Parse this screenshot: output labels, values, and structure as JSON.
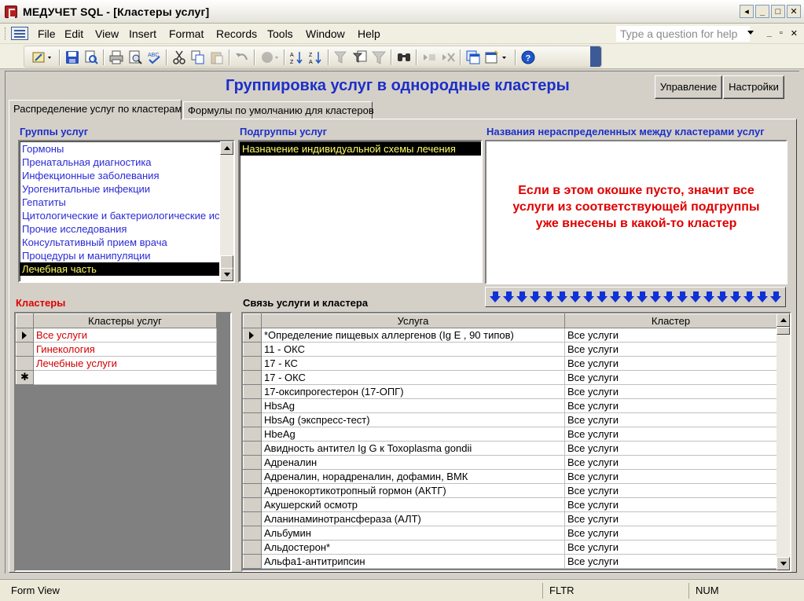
{
  "window": {
    "title": "МЕДУЧЕТ SQL - [Кластеры услуг]",
    "buttons": [
      "◂",
      "_",
      "□",
      "✕"
    ]
  },
  "menubar": {
    "items": [
      "File",
      "Edit",
      "View",
      "Insert",
      "Format",
      "Records",
      "Tools",
      "Window",
      "Help"
    ],
    "help_placeholder": "Type a question for help",
    "mdi_buttons": [
      "_",
      "▫",
      "✕"
    ]
  },
  "toolbar": {
    "icons": [
      "design-view",
      "save",
      "file-search",
      "print",
      "print-preview",
      "spelling",
      "cut",
      "copy",
      "paste",
      "undo",
      "office-links",
      "sort-ascending",
      "sort-descending",
      "filter-by-selection",
      "filter-by-form",
      "apply-filter",
      "find",
      "new-record",
      "delete-record",
      "database-window",
      "new-object",
      "help"
    ],
    "colors": {
      "blue": "#1f56c8",
      "red": "#c03030"
    }
  },
  "form": {
    "title": "Группировка услуг в однородные кластеры",
    "btn_manage": "Управление",
    "btn_settings": "Настройки",
    "tabs": [
      "Распределение услуг по кластерам",
      "Формулы по умолчанию для кластеров"
    ],
    "groups_label": "Группы услуг",
    "subgroups_label": "Подгруппы услуг",
    "unassigned_label": "Названия нераспределенных между кластерами услуг",
    "clusters_label": "Кластеры",
    "link_label": "Связь услуги и кластера",
    "groups": [
      "Гормоны",
      "Пренатальная диагностика",
      "Инфекционные заболевания",
      "Урогенитальные инфекции",
      "Гепатиты",
      "Цитологические и бактериологические исс",
      "Прочие исследования",
      "Консультативный прием врача",
      "Процедуры и манипуляции",
      "Лечебная часть"
    ],
    "groups_selected_index": 9,
    "subgroups": [
      "Назначение индивидуальной схемы лечения"
    ],
    "note": "Если в этом окошке пусто, значит все услуги из соответствующей подгруппы уже внесены в какой-то кластер",
    "clusters_header": "Кластеры услуг",
    "clusters": [
      "Все услуги",
      "Гинекология",
      "Лечебные услуги"
    ],
    "link_headers": [
      "Услуга",
      "Кластер"
    ],
    "services": [
      [
        "*Определение пищевых аллергенов (Ig E , 90 типов)",
        "Все услуги"
      ],
      [
        "11 - ОКС",
        "Все услуги"
      ],
      [
        "17 - КС",
        "Все услуги"
      ],
      [
        "17 - ОКС",
        "Все услуги"
      ],
      [
        "17-оксипрогестерон (17-ОПГ)",
        "Все услуги"
      ],
      [
        "HbsAg",
        "Все услуги"
      ],
      [
        "HbsAg (экспресс-тест)",
        "Все услуги"
      ],
      [
        "HbeAg",
        "Все услуги"
      ],
      [
        "Авидность антител Ig G к Toxoplasma gondii",
        "Все услуги"
      ],
      [
        "Адреналин",
        "Все услуги"
      ],
      [
        "Адреналин, норадреналин, дофамин, ВМК",
        "Все услуги"
      ],
      [
        "Адренокортикотропный гормон (АКТГ)",
        "Все услуги"
      ],
      [
        "Акушерский осмотр",
        "Все услуги"
      ],
      [
        "Аланинаминотрансфераза (АЛТ)",
        "Все услуги"
      ],
      [
        "Альбумин",
        "Все услуги"
      ],
      [
        "Альдостерон*",
        "Все услуги"
      ],
      [
        "Альфа1-антитрипсин",
        "Все услуги"
      ]
    ]
  },
  "statusbar": {
    "view": "Form View",
    "filter": "FLTR",
    "num": "NUM"
  }
}
